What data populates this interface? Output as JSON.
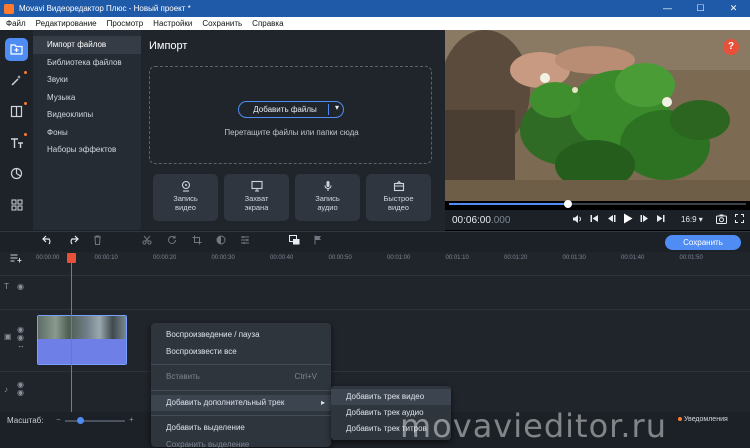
{
  "window": {
    "title": "Movavi Видеоредактор Плюс - Новый проект *",
    "controls": [
      "—",
      "☐",
      "✕"
    ]
  },
  "menu": [
    "Файл",
    "Редактирование",
    "Просмотр",
    "Настройки",
    "Сохранить",
    "Справка"
  ],
  "sidebar_icons": [
    "import-icon",
    "magic-wand-icon",
    "transitions-icon",
    "titles-icon",
    "stickers-icon",
    "grid-icon"
  ],
  "categories": [
    {
      "label": "Импорт файлов",
      "active": true
    },
    {
      "label": "Библиотека файлов"
    },
    {
      "label": "Звуки"
    },
    {
      "label": "Музыка"
    },
    {
      "label": "Видеоклипы"
    },
    {
      "label": "Фоны"
    },
    {
      "label": "Наборы эффектов"
    }
  ],
  "import": {
    "title": "Импорт",
    "add_files": "Добавить файлы",
    "drop_hint": "Перетащите файлы или папки сюда",
    "tiles": [
      {
        "label": "Запись\nвидео",
        "icon": "webcam-icon"
      },
      {
        "label": "Захват\nэкрана",
        "icon": "monitor-icon"
      },
      {
        "label": "Запись\nаудио",
        "icon": "microphone-icon"
      },
      {
        "label": "Быстрое\nвидео",
        "icon": "magic-box-icon"
      }
    ]
  },
  "preview": {
    "help": "?",
    "progress": 0.4,
    "timecode_main": "00:06:00",
    "timecode_ms": ".000",
    "aspect": "16:9 ▾"
  },
  "toolbar": {
    "save": "Сохранить"
  },
  "ruler": [
    "00:00:00",
    "00:00:10",
    "00:00:20",
    "00:00:30",
    "00:00:40",
    "00:00:50",
    "00:01:00",
    "00:01:10",
    "00:01:20",
    "00:01:30",
    "00:01:40",
    "00:01:50"
  ],
  "scale": {
    "label": "Масштаб:",
    "value": 0.25
  },
  "notifications": "Уведомления",
  "context_menu": {
    "items": [
      {
        "label": "Воспроизведение / пауза"
      },
      {
        "label": "Воспроизвести все"
      },
      {
        "label": "Вставить",
        "shortcut": "Ctrl+V",
        "disabled": true
      },
      {
        "label": "Добавить дополнительный трек",
        "submenu": true
      },
      {
        "label": "Добавить выделение"
      },
      {
        "label": "Сохранить выделение",
        "disabled": true
      }
    ],
    "submenu": [
      "Добавить трек видео",
      "Добавить трек аудио",
      "Добавить трек титров"
    ]
  },
  "watermark": "movavieditor.ru",
  "colors": {
    "accent": "#4f8df5",
    "playhead": "#e8503a",
    "title_bar": "#1f5aa8"
  }
}
